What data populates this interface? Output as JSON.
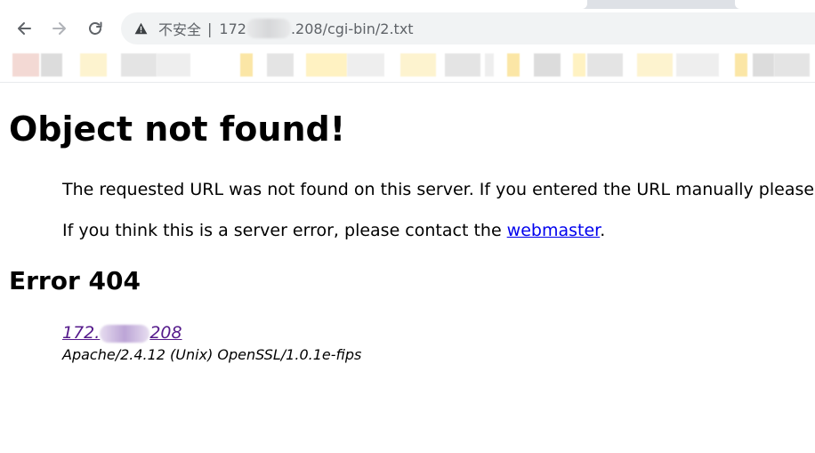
{
  "browser": {
    "security_label": "不安全",
    "separator": "|",
    "url_host_start": "172",
    "url_host_end": ".208",
    "url_path": "/cgi-bin/2.txt",
    "icons": {
      "back": "arrow-left-icon",
      "forward": "arrow-right-icon",
      "reload": "reload-icon",
      "security": "warning-triangle-icon"
    }
  },
  "bookmarks": {
    "colors": [
      "#f3d9d4",
      "#fdf3cf",
      "#e4e4e4",
      "#fbe6a6",
      "#eeeeee",
      "#fff2c2",
      "#dcdcdc"
    ]
  },
  "page": {
    "title": "Object not found!",
    "paragraph1": "The requested URL was not found on this server. If you entered the URL manually please check your spelling and try again.",
    "paragraph2_before": "If you think this is a server error, please contact the ",
    "paragraph2_link": "webmaster",
    "paragraph2_after": ".",
    "error_heading": "Error 404",
    "server_link_start": "172.",
    "server_link_end": "208",
    "server_signature": "Apache/2.4.12 (Unix) OpenSSL/1.0.1e-fips"
  },
  "colors": {
    "link": "#0000ee",
    "visited_link": "#551a8b",
    "omnibox_bg": "#f1f3f4"
  }
}
